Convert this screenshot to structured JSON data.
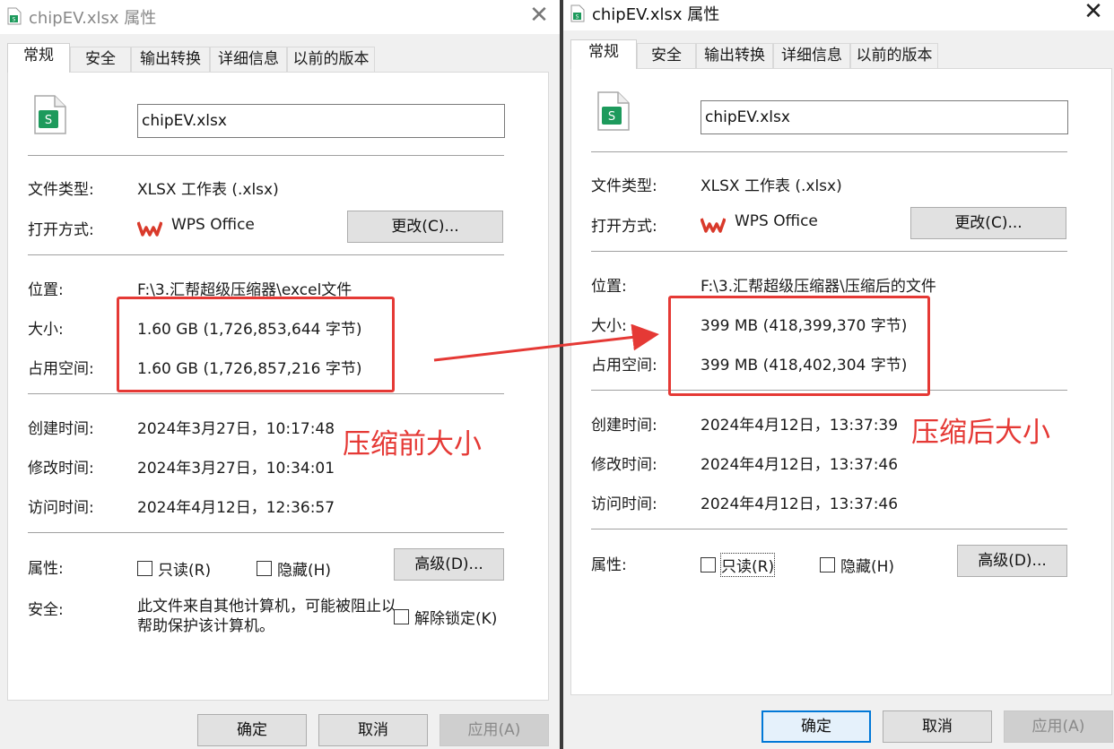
{
  "colors": {
    "accent": "#0078d7",
    "annotation": "#e53935",
    "sheet_icon": "#1d9a5c",
    "wps_red": "#d93a2b"
  },
  "left": {
    "title": "chipEV.xlsx 属性",
    "tabs": [
      "常规",
      "安全",
      "输出转换",
      "详细信息",
      "以前的版本"
    ],
    "file_name": "chipEV.xlsx",
    "file_type_label": "文件类型:",
    "file_type_value": "XLSX 工作表 (.xlsx)",
    "open_with_label": "打开方式:",
    "open_with_value": "WPS Office",
    "change_button": "更改(C)...",
    "location_label": "位置:",
    "location_value": "F:\\3.汇帮超级压缩器\\excel文件",
    "size_label": "大小:",
    "size_value": "1.60 GB (1,726,853,644 字节)",
    "disk_label": "占用空间:",
    "disk_value": "1.60 GB (1,726,857,216 字节)",
    "created_label": "创建时间:",
    "created_value": "2024年3月27日，10:17:48",
    "modified_label": "修改时间:",
    "modified_value": "2024年3月27日，10:34:01",
    "accessed_label": "访问时间:",
    "accessed_value": "2024年4月12日，12:36:57",
    "attributes_label": "属性:",
    "readonly_label": "只读(R)",
    "hidden_label": "隐藏(H)",
    "advanced_button": "高级(D)...",
    "security_label": "安全:",
    "security_text": "此文件来自其他计算机，可能被阻止以帮助保护该计算机。",
    "unblock_label": "解除锁定(K)",
    "ok_button": "确定",
    "cancel_button": "取消",
    "apply_button": "应用(A)",
    "annotation": "压缩前大小"
  },
  "right": {
    "title": "chipEV.xlsx 属性",
    "tabs": [
      "常规",
      "安全",
      "输出转换",
      "详细信息",
      "以前的版本"
    ],
    "file_name": "chipEV.xlsx",
    "file_type_label": "文件类型:",
    "file_type_value": "XLSX 工作表 (.xlsx)",
    "open_with_label": "打开方式:",
    "open_with_value": "WPS Office",
    "change_button": "更改(C)...",
    "location_label": "位置:",
    "location_value": "F:\\3.汇帮超级压缩器\\压缩后的文件",
    "size_label": "大小:",
    "size_value": "399 MB (418,399,370 字节)",
    "disk_label": "占用空间:",
    "disk_value": "399 MB (418,402,304 字节)",
    "created_label": "创建时间:",
    "created_value": "2024年4月12日，13:37:39",
    "modified_label": "修改时间:",
    "modified_value": "2024年4月12日，13:37:46",
    "accessed_label": "访问时间:",
    "accessed_value": "2024年4月12日，13:37:46",
    "attributes_label": "属性:",
    "readonly_label": "只读(R)",
    "hidden_label": "隐藏(H)",
    "advanced_button": "高级(D)...",
    "ok_button": "确定",
    "cancel_button": "取消",
    "apply_button": "应用(A)",
    "annotation": "压缩后大小"
  }
}
